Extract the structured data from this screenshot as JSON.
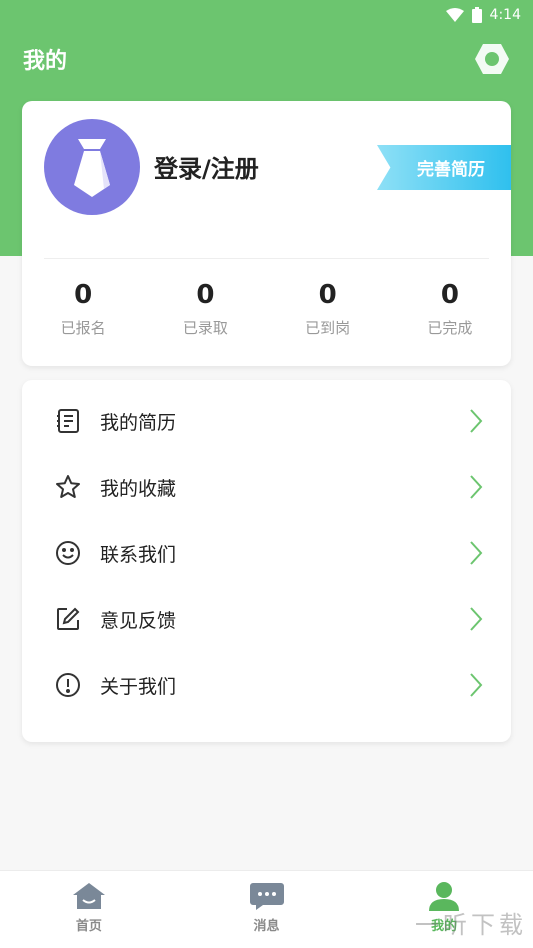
{
  "status_bar": {
    "time": "4:14"
  },
  "header": {
    "title": "我的"
  },
  "profile": {
    "login_label": "登录/注册",
    "resume_badge": "完善简历"
  },
  "stats": [
    {
      "value": "0",
      "label": "已报名"
    },
    {
      "value": "0",
      "label": "已录取"
    },
    {
      "value": "0",
      "label": "已到岗"
    },
    {
      "value": "0",
      "label": "已完成"
    }
  ],
  "menu": [
    {
      "label": "我的简历",
      "icon": "resume-icon"
    },
    {
      "label": "我的收藏",
      "icon": "star-icon"
    },
    {
      "label": "联系我们",
      "icon": "smile-icon"
    },
    {
      "label": "意见反馈",
      "icon": "edit-icon"
    },
    {
      "label": "关于我们",
      "icon": "info-icon"
    }
  ],
  "tabs": [
    {
      "label": "首页",
      "icon": "home-icon"
    },
    {
      "label": "消息",
      "icon": "message-icon"
    },
    {
      "label": "我的",
      "icon": "user-icon",
      "active": true
    }
  ],
  "watermark": "一听下载",
  "colors": {
    "primary_green": "#6cc56f",
    "avatar_purple": "#7f7be0",
    "badge_blue": "#2fc0ee",
    "arrow_green": "#6cc56f"
  }
}
